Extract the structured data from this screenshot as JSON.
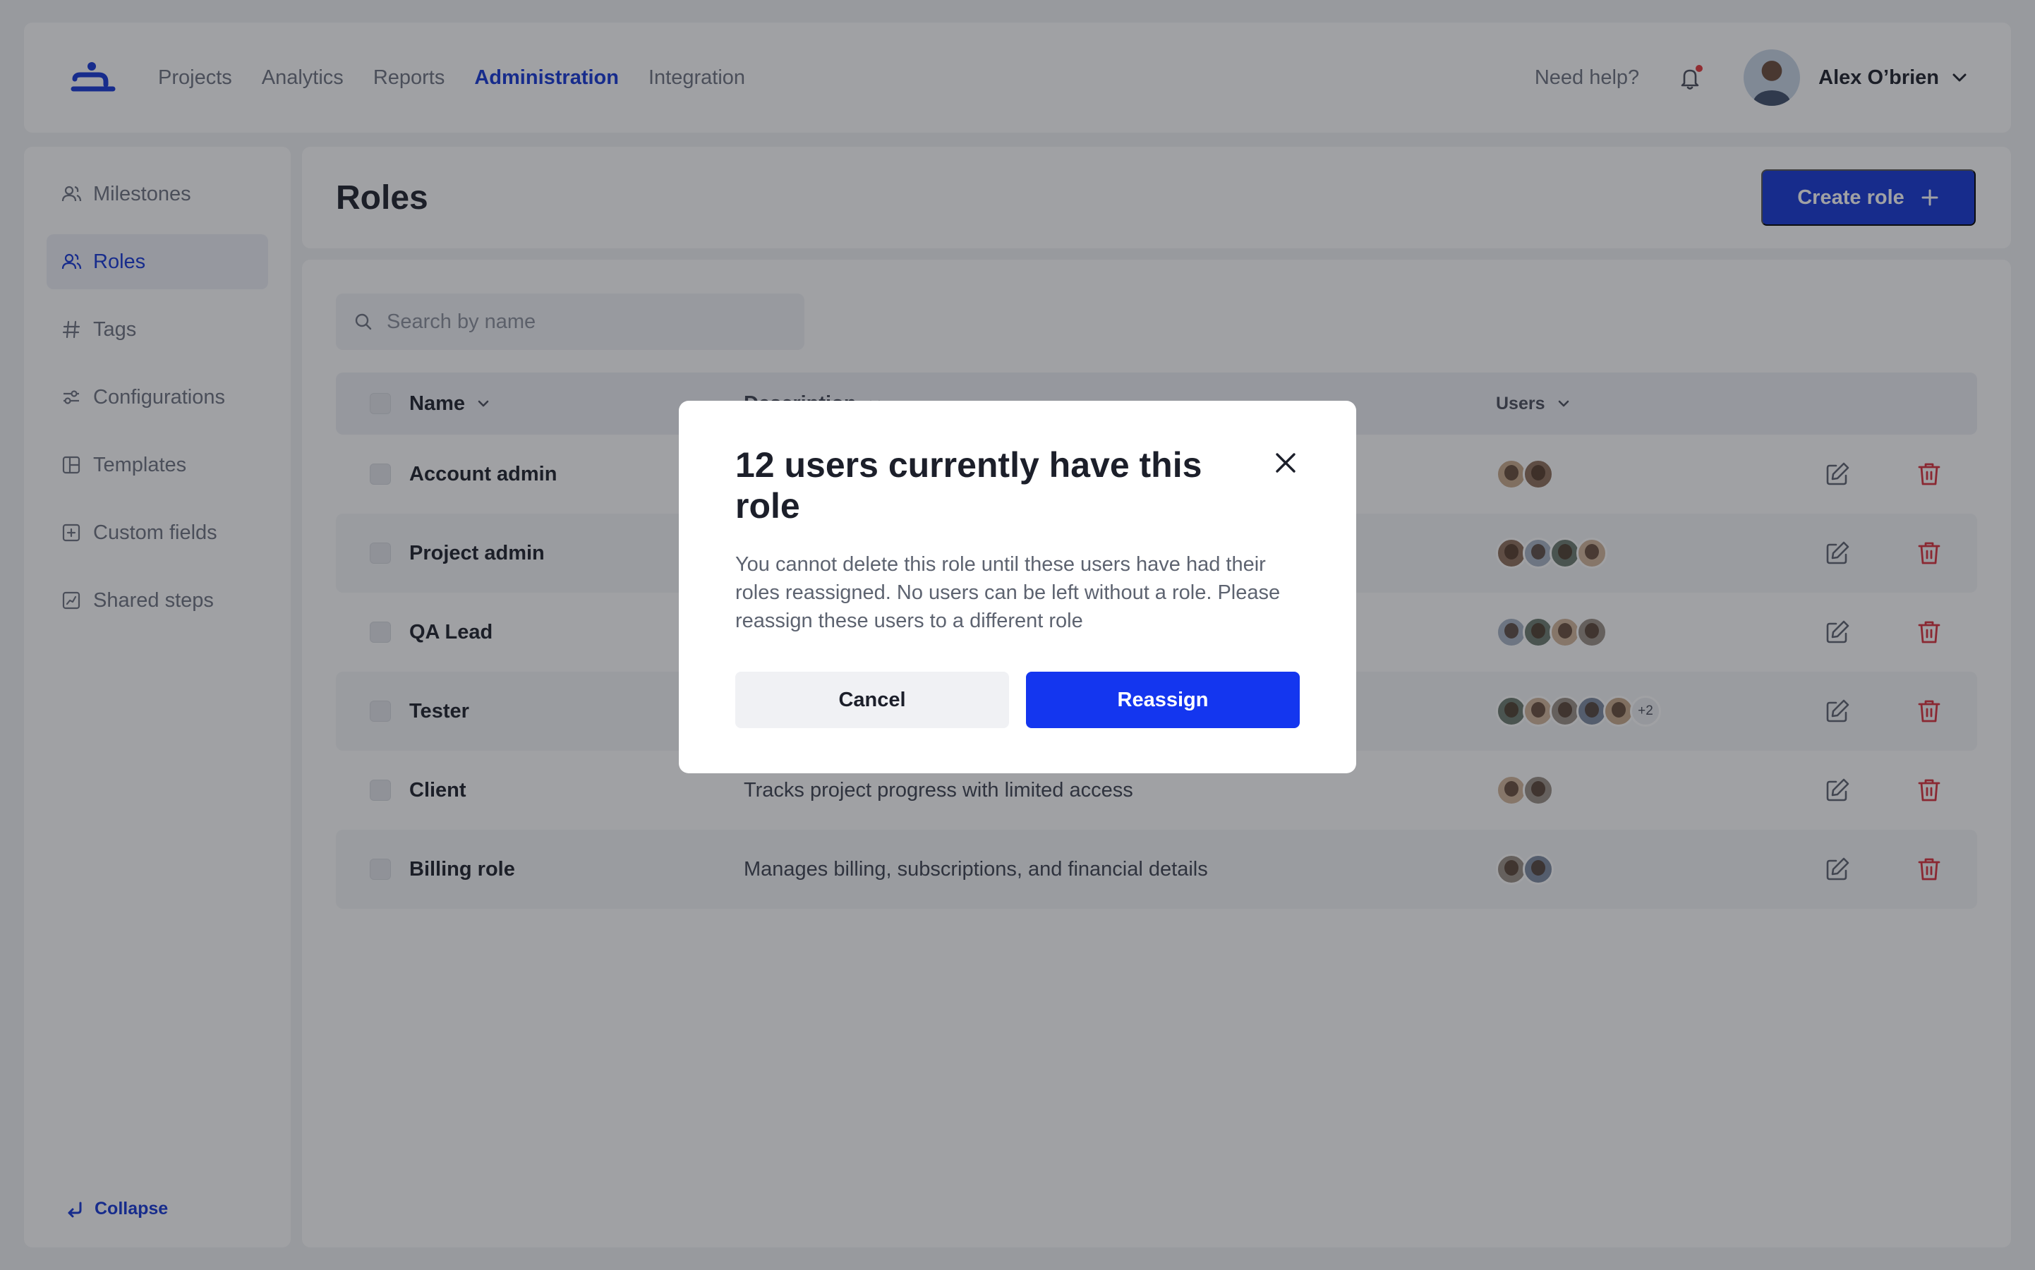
{
  "nav": {
    "items": [
      "Projects",
      "Analytics",
      "Reports",
      "Administration",
      "Integration"
    ],
    "active": "Administration",
    "help": "Need help?",
    "user_name": "Alex O’brien"
  },
  "sidebar": {
    "items": [
      {
        "label": "Milestones",
        "icon": "users-icon"
      },
      {
        "label": "Roles",
        "icon": "users-icon",
        "active": true
      },
      {
        "label": "Tags",
        "icon": "hash-icon"
      },
      {
        "label": "Configurations",
        "icon": "sliders-icon"
      },
      {
        "label": "Templates",
        "icon": "layout-icon"
      },
      {
        "label": "Custom fields",
        "icon": "plus-square-icon"
      },
      {
        "label": "Shared steps",
        "icon": "chart-square-icon"
      }
    ],
    "collapse": "Collapse"
  },
  "header": {
    "title": "Roles",
    "create_label": "Create role"
  },
  "search": {
    "placeholder": "Search by name"
  },
  "table": {
    "columns": {
      "name": "Name",
      "description": "Description",
      "users": "Users"
    },
    "rows": [
      {
        "name": "Account admin",
        "description": "",
        "avatars": 2,
        "extra": ""
      },
      {
        "name": "Project admin",
        "description": "",
        "avatars": 4,
        "extra": ""
      },
      {
        "name": "QA Lead",
        "description": "",
        "avatars": 4,
        "extra": ""
      },
      {
        "name": "Tester",
        "description": "",
        "avatars": 5,
        "extra": "+2"
      },
      {
        "name": "Client",
        "description": "Tracks project progress with limited access",
        "avatars": 2,
        "extra": ""
      },
      {
        "name": "Billing role",
        "description": "Manages billing, subscriptions, and financial details",
        "avatars": 2,
        "extra": ""
      }
    ]
  },
  "modal": {
    "title": "12 users currently have this role",
    "body": "You cannot delete this role until these users have had their roles reassigned. No users can be left without a role. Please reassign these users to a different role",
    "cancel": "Cancel",
    "reassign": "Reassign"
  },
  "colors": {
    "accent": "#1436d6",
    "danger": "#d9303c",
    "overlay": "rgba(28,30,38,0.42)"
  }
}
